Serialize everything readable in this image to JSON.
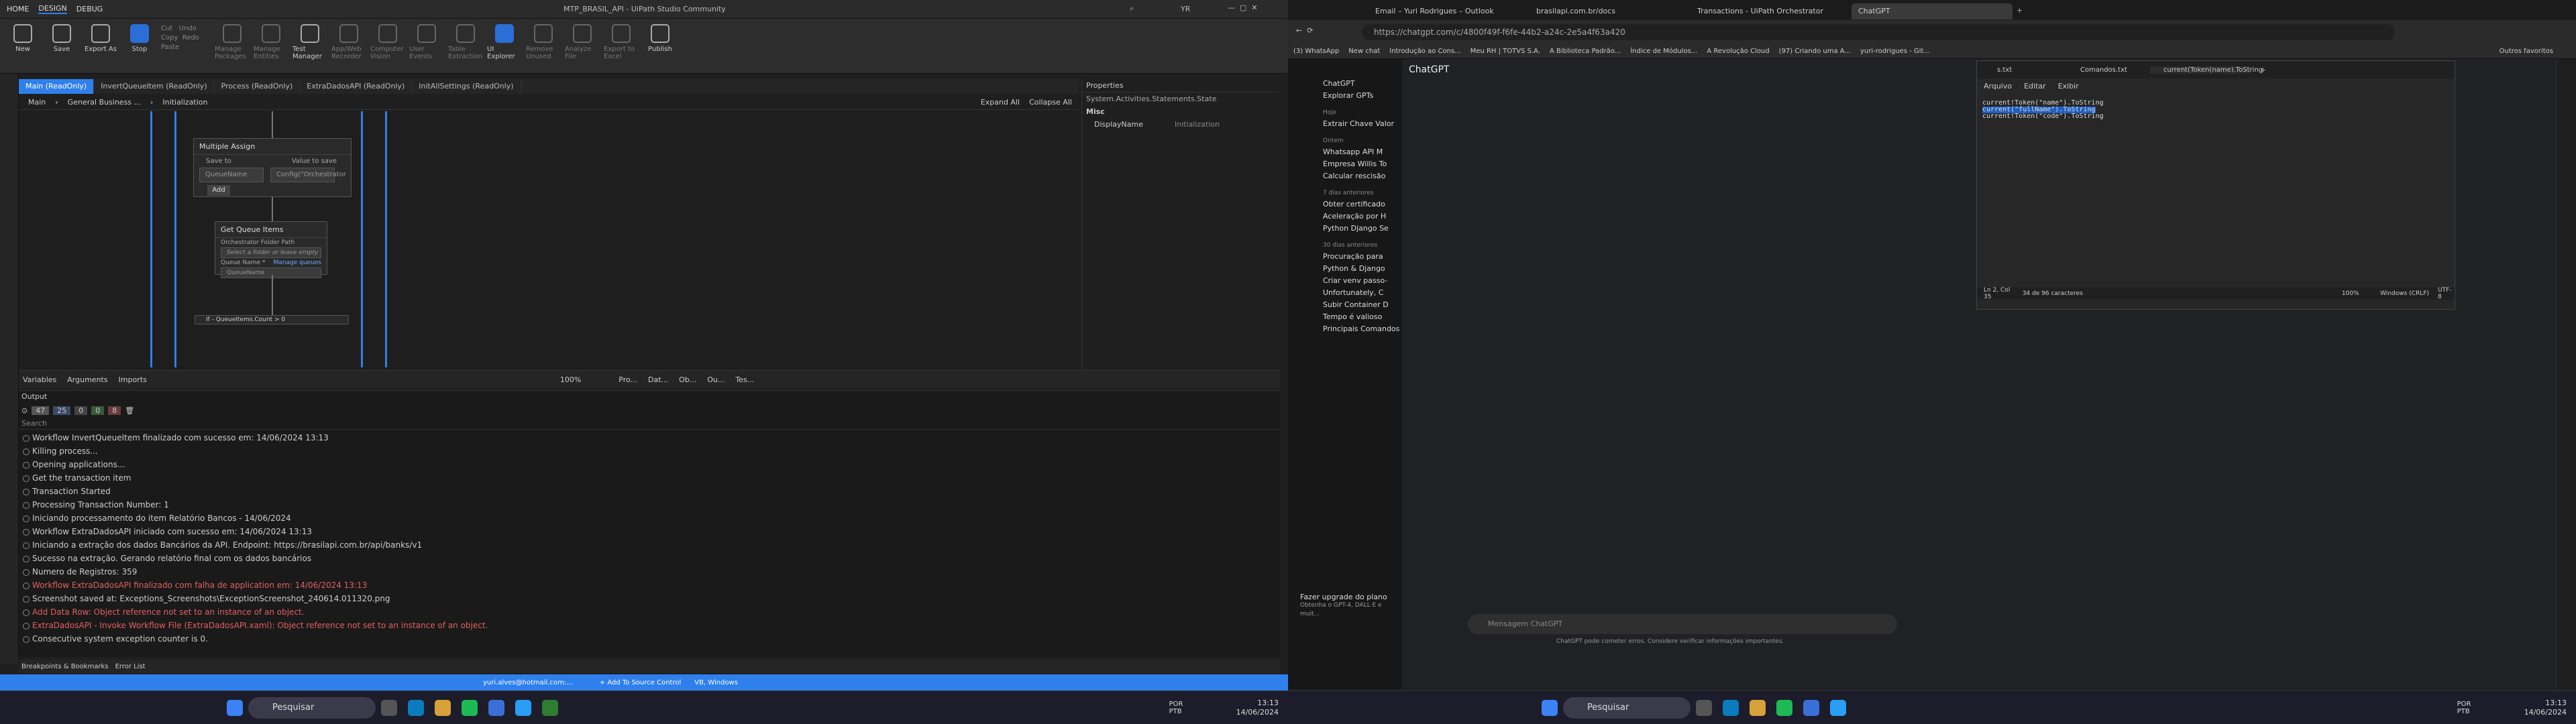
{
  "uipath": {
    "title": "MTP_BRASIL_API - UiPath Studio Community",
    "tabs": [
      "HOME",
      "DESIGN",
      "DEBUG"
    ],
    "ribbon": [
      "New",
      "Save",
      "Export As",
      "Stop",
      "Cut",
      "Copy",
      "Paste",
      "Undo",
      "Redo",
      "Manage Packages",
      "Manage Entities",
      "Test Manager",
      "App/Web Recorder",
      "Computer Vision",
      "User Events",
      "Table Extraction",
      "UI Explorer",
      "Remove Unused",
      "Analyze File",
      "Export to Excel",
      "Publish"
    ],
    "user": "YR",
    "doc_tabs": [
      "Main (ReadOnly)",
      "InvertQueueItem (ReadOnly)",
      "Process (ReadOnly)",
      "ExtraDadosAPI (ReadOnly)",
      "InitAllSettings (ReadOnly)"
    ],
    "breadcrumb": [
      "Main",
      "General Business ...",
      "Initialization"
    ],
    "expand_all": "Expand All",
    "collapse_all": "Collapse All",
    "multiple_assign": {
      "title": "Multiple Assign",
      "save_to": "Save to",
      "value_to_save": "Value to save",
      "field1": "QueueName",
      "field2": "Config(\"Orchestrator",
      "add": "Add"
    },
    "get_queue": {
      "title": "Get Queue Items",
      "folder_label": "Orchestrator Folder Path",
      "folder_ph": "Select a folder or leave empty for current a",
      "queue_label": "Queue Name *",
      "manage": "Manage queues",
      "queue_val": "QueueName"
    },
    "if_label": "If - QueueItems.Count > 0",
    "properties": {
      "title": "Properties",
      "class": "System.Activities.Statements.State",
      "misc": "Misc",
      "displayname_k": "DisplayName",
      "displayname_v": "Initialization"
    },
    "var_tabs": [
      "Variables",
      "Arguments",
      "Imports"
    ],
    "zoom": "100%",
    "panel_tabs": [
      "Pro...",
      "Dat...",
      "Ob...",
      "Ou...",
      "Tes..."
    ],
    "output_title": "Output",
    "output_counts": [
      "47",
      "25",
      "0",
      "0",
      "8"
    ],
    "search_ph": "Search",
    "logs": [
      {
        "t": "Workflow InvertQueueItem finalizado com sucesso em: 14/06/2024 13:13",
        "e": false
      },
      {
        "t": "Killing process...",
        "e": false
      },
      {
        "t": "Opening applications...",
        "e": false
      },
      {
        "t": "Get the transaction item",
        "e": false
      },
      {
        "t": "Transaction Started",
        "e": false
      },
      {
        "t": "Processing Transaction Number: 1",
        "e": false
      },
      {
        "t": "Iniciando processamento do item Relatório Bancos - 14/06/2024",
        "e": false
      },
      {
        "t": "Workflow ExtraDadosAPI iniciado com sucesso em: 14/06/2024 13:13",
        "e": false
      },
      {
        "t": "Iniciando a extração dos dados Bancários da API. Endpoint: https://brasilapi.com.br/api/banks/v1",
        "e": false
      },
      {
        "t": "Sucesso na extração. Gerando relatório final com os dados bancários",
        "e": false
      },
      {
        "t": "Numero de Registros: 359",
        "e": false
      },
      {
        "t": "Workflow ExtraDadosAPI finalizado com falha de application em: 14/06/2024 13:13",
        "e": true
      },
      {
        "t": "Screenshot saved at: Exceptions_Screenshots\\ExceptionScreenshot_240614.011320.png",
        "e": false
      },
      {
        "t": "Add Data Row: Object reference not set to an instance of an object.",
        "e": true
      },
      {
        "t": "ExtraDadosAPI - Invoke Workflow File (ExtraDadosAPI.xaml): Object reference not set to an instance of an object.",
        "e": true
      },
      {
        "t": "Consecutive system exception counter is 0.",
        "e": false
      }
    ],
    "bottom_tabs": [
      "Breakpoints & Bookmarks",
      "Error List"
    ],
    "status": {
      "account": "yuri.alves@hotmail.com:...",
      "source": "+ Add To Source Control",
      "os": "VB, Windows"
    }
  },
  "taskbar_left": {
    "search": "Pesquisar",
    "lang": "POR PTB",
    "time": "13:13",
    "date": "14/06/2024"
  },
  "taskbar_right": {
    "search": "Pesquisar",
    "lang": "POR PTB",
    "time": "13:13",
    "date": "14/06/2024"
  },
  "browser": {
    "tabs": [
      "Email – Yuri Rodrigues – Outlook",
      "brasilapi.com.br/docs",
      "Transactions - UiPath Orchestrator",
      "ChatGPT"
    ],
    "url": "https://chatgpt.com/c/4800f49f-f6fe-44b2-a24c-2e5a4f63a420",
    "favs": [
      "(3) WhatsApp",
      "New chat",
      "Introdução ao Cons...",
      "Meu RH | TOTVS S.A.",
      "A Biblioteca Padrão...",
      "Índice de Módulos...",
      "A Revolução Cloud",
      "(97) Criando uma A...",
      "yuri-rodrigues - Git..."
    ],
    "favs_other": "Outros favoritos",
    "model": "ChatGPT",
    "side": {
      "items_top": [
        "ChatGPT",
        "Explorar GPTs"
      ],
      "groups": [
        {
          "h": "Hoje",
          "items": [
            "Extrair Chave Valor"
          ]
        },
        {
          "h": "Ontem",
          "items": [
            "Whatsapp API M",
            "Empresa Willis To",
            "Calcular rescisão"
          ]
        },
        {
          "h": "7 dias anteriores",
          "items": [
            "Obter certificado",
            "Aceleração por H",
            "Python Django Se"
          ]
        },
        {
          "h": "30 dias anteriores",
          "items": [
            "Procuração para",
            "Python & Django",
            "Criar venv passo-",
            "Unfortunately, C",
            "Subir Container D",
            "Tempo é valioso",
            "Principais Comandos Docker"
          ]
        }
      ],
      "upgrade": "Fazer upgrade do plano",
      "upgrade_sub": "Obtenha o GPT-4, DALL·E e muit..."
    },
    "input_ph": "Mensagem ChatGPT",
    "disclaimer": "ChatGPT pode cometer erros. Considere verificar informações importantes."
  },
  "notepad": {
    "tabs": [
      "s.txt",
      "Comandos.txt",
      "current(Token(name).ToString"
    ],
    "menu": [
      "Arquivo",
      "Editar",
      "Exibir"
    ],
    "lines": [
      "current!Token(\"name\").ToString",
      "current(\"fullName\").ToString",
      "current!Token(\"code\").ToString"
    ],
    "status": {
      "pos": "Ln 2, Col 35",
      "chars": "34 de 96 caracteres",
      "zoom": "100%",
      "eol": "Windows (CRLF)",
      "enc": "UTF-8"
    }
  }
}
